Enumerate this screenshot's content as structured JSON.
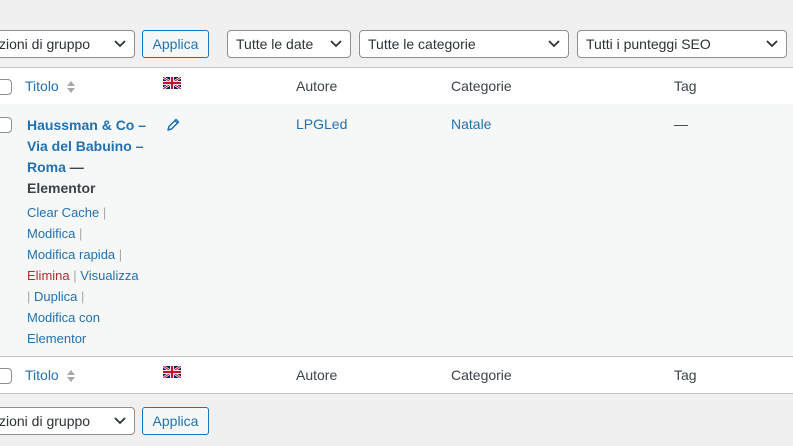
{
  "top_bar": {
    "bulk_actions": "zioni di gruppo",
    "apply": "Applica",
    "dates_filter": "Tutte le date",
    "categories_filter": "Tutte le categorie",
    "seo_filter": "Tutti i punteggi SEO"
  },
  "columns": {
    "title": "Titolo",
    "author": "Autore",
    "categories": "Categorie",
    "tags": "Tag"
  },
  "row": {
    "title": "Haussman & Co – Via del Babuino – Roma",
    "title_suffix": "— Elementor",
    "author": "LPGLed",
    "category": "Natale",
    "tags": "—",
    "actions": {
      "clear_cache": "Clear Cache",
      "edit": "Modifica",
      "quick_edit": "Modifica rapida",
      "delete": "Elimina",
      "view": "Visualizza",
      "duplicate": "Duplica",
      "edit_elementor": "Modifica con Elementor",
      "separator": "|"
    }
  },
  "bottom_bar": {
    "bulk_actions": "zioni di gruppo",
    "apply": "Applica"
  },
  "colors": {
    "link": "#2271b1",
    "delete": "#b32d2e",
    "background": "#f0f0f1"
  }
}
